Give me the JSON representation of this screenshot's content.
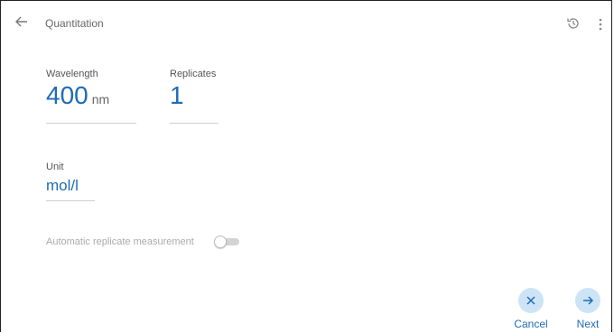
{
  "header": {
    "title": "Quantitation"
  },
  "wavelength": {
    "label": "Wavelength",
    "value": "400",
    "unit": "nm"
  },
  "replicates": {
    "label": "Replicates",
    "value": "1"
  },
  "unit": {
    "label": "Unit",
    "value": "mol/l"
  },
  "auto_replicate": {
    "label": "Automatic replicate measurement",
    "enabled": false
  },
  "actions": {
    "cancel": "Cancel",
    "next": "Next"
  },
  "colors": {
    "accent": "#1e6bb8",
    "button_bg": "#cde4f7"
  },
  "icons": [
    "back-arrow-icon",
    "history-icon",
    "more-vert-icon",
    "close-icon",
    "arrow-right-icon"
  ]
}
